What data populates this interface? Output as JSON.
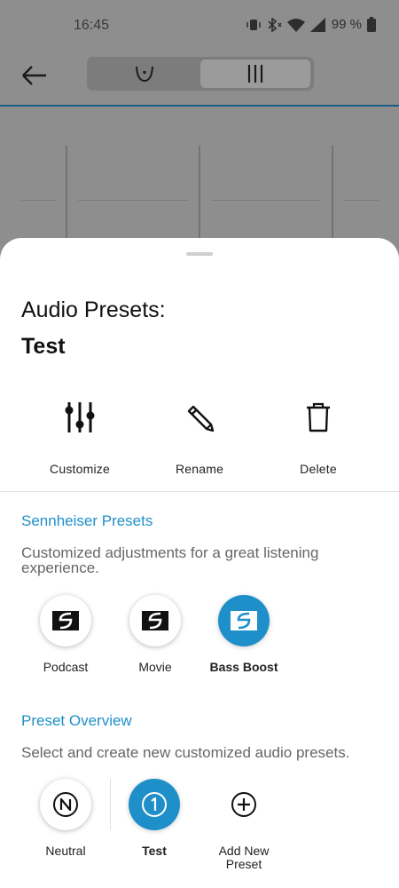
{
  "status_bar": {
    "time": "16:45",
    "battery": "99 %"
  },
  "sheet": {
    "title": "Audio Presets:",
    "current_preset": "Test",
    "actions": [
      {
        "label": "Customize",
        "icon": "sliders-icon"
      },
      {
        "label": "Rename",
        "icon": "pencil-icon"
      },
      {
        "label": "Delete",
        "icon": "trash-icon"
      }
    ],
    "sennheiser_presets": {
      "title": "Sennheiser Presets",
      "description": "Customized adjustments for a great listening experience.",
      "items": [
        {
          "label": "Podcast",
          "active": false
        },
        {
          "label": "Movie",
          "active": false
        },
        {
          "label": "Bass Boost",
          "active": true
        }
      ]
    },
    "preset_overview": {
      "title": "Preset Overview",
      "description": "Select and create new customized audio presets.",
      "items": [
        {
          "label": "Neutral",
          "glyph": "N",
          "active": false
        },
        {
          "label": "Test",
          "glyph": "1",
          "active": true
        },
        {
          "label": "Add New Preset",
          "glyph": "+",
          "active": false
        }
      ]
    }
  },
  "colors": {
    "accent": "#1f8fc9",
    "scrim": "#8e8e8e",
    "sheet": "#ffffff"
  }
}
